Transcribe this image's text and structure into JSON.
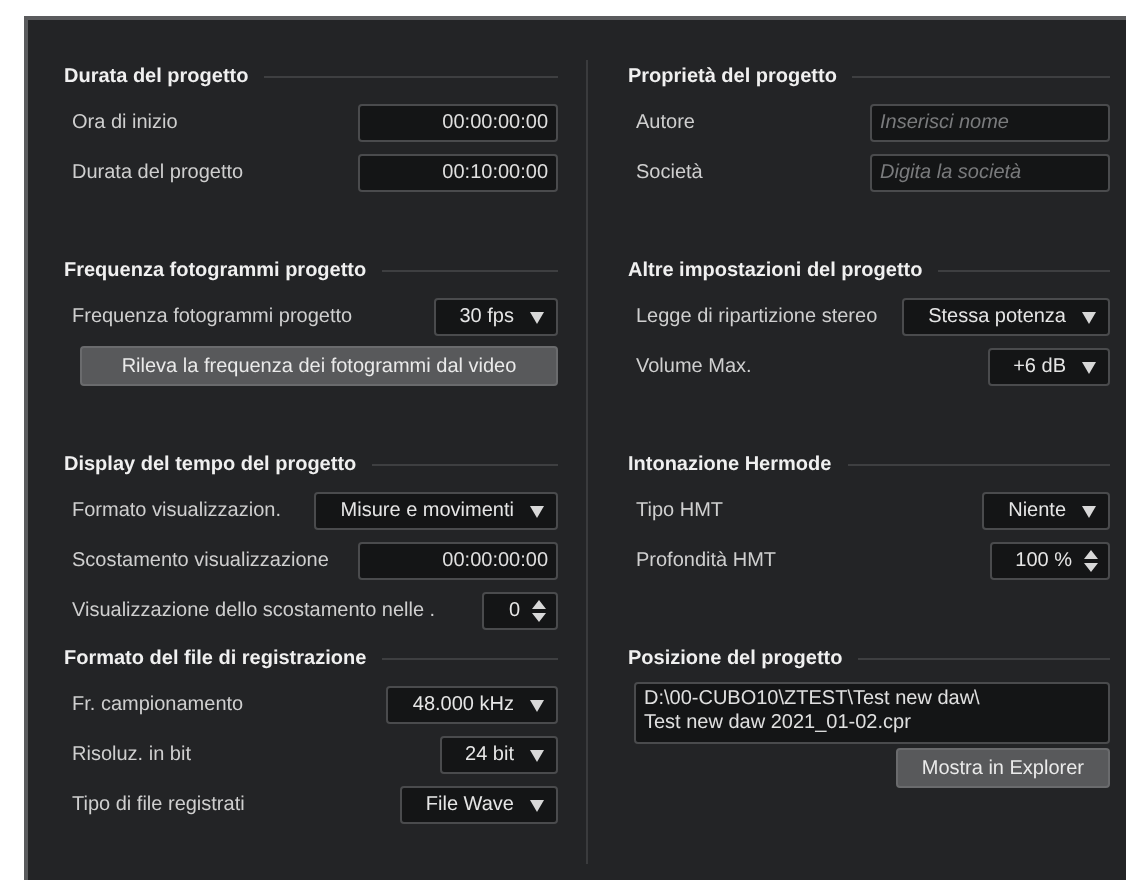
{
  "columns": [
    {
      "sections": [
        {
          "title": "Durata del progetto",
          "rows": [
            {
              "kind": "field",
              "label": "Ora di inizio",
              "value": "00:00:00:00"
            },
            {
              "kind": "field",
              "label": "Durata del progetto",
              "value": "00:10:00:00"
            }
          ]
        },
        {
          "title": "Frequenza fotogrammi progetto",
          "rows": [
            {
              "kind": "dropdown",
              "label": "Frequenza fotogrammi progetto",
              "value": "30 fps"
            },
            {
              "kind": "button",
              "label": "Rileva la frequenza dei fotogrammi dal video"
            }
          ]
        },
        {
          "title": "Display del tempo del progetto",
          "rows": [
            {
              "kind": "dropdown",
              "label": "Formato visualizzazion.",
              "value": "Misure e movimenti"
            },
            {
              "kind": "field",
              "label": "Scostamento visualizzazione",
              "value": "00:00:00:00"
            },
            {
              "kind": "spinner",
              "label": "Visualizzazione dello scostamento nelle .",
              "value": "0"
            }
          ]
        },
        {
          "title": "Formato del file di registrazione",
          "rows": [
            {
              "kind": "dropdown",
              "label": "Fr. campionamento",
              "value": "48.000 kHz"
            },
            {
              "kind": "dropdown",
              "label": "Risoluz. in bit",
              "value": "24 bit"
            },
            {
              "kind": "dropdown",
              "label": "Tipo di file registrati",
              "value": "File Wave"
            }
          ]
        }
      ]
    },
    {
      "sections": [
        {
          "title": "Proprietà del progetto",
          "rows": [
            {
              "kind": "input",
              "label": "Autore",
              "placeholder": "Inserisci nome"
            },
            {
              "kind": "input",
              "label": "Società",
              "placeholder": "Digita la società"
            }
          ]
        },
        {
          "title": "Altre impostazioni del progetto",
          "rows": [
            {
              "kind": "dropdown",
              "label": "Legge di ripartizione stereo",
              "value": "Stessa potenza"
            },
            {
              "kind": "dropdown",
              "label": "Volume Max.",
              "value": "+6 dB"
            }
          ]
        },
        {
          "title": "Intonazione Hermode",
          "rows": [
            {
              "kind": "dropdown",
              "label": "Tipo HMT",
              "value": "Niente"
            },
            {
              "kind": "spinner",
              "label": "Profondità HMT",
              "value": "100 %"
            }
          ]
        },
        {
          "title": "Posizione del progetto",
          "rows": [
            {
              "kind": "path",
              "lines": [
                "D:\\00-CUBO10\\ZTEST\\Test new daw\\",
                "Test new daw 2021_01-02.cpr"
              ]
            },
            {
              "kind": "small_button",
              "label": "Mostra in Explorer"
            }
          ]
        }
      ]
    }
  ]
}
